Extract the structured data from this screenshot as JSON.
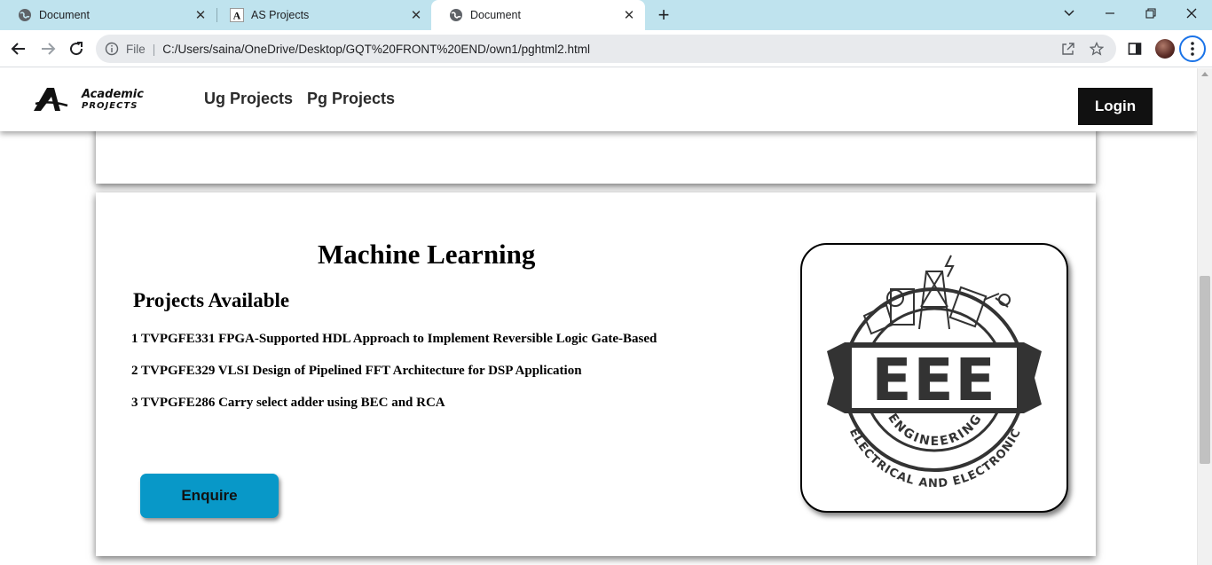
{
  "browser": {
    "tabs": [
      {
        "title": "Document",
        "icon": "globe-icon",
        "active": false
      },
      {
        "title": "AS Projects",
        "icon": "site-a-icon",
        "active": false
      },
      {
        "title": "Document",
        "icon": "globe-icon",
        "active": true
      }
    ],
    "address": {
      "scheme_label": "File",
      "url": "C:/Users/saina/OneDrive/Desktop/GQT%20FRONT%20END/own1/pghtml2.html"
    }
  },
  "header": {
    "logo_text_top": "Academic",
    "logo_text_bottom": "PROJECTS",
    "nav": [
      "Ug Projects",
      "Pg Projects"
    ],
    "login_label": "Login"
  },
  "section": {
    "title": "Machine Learning",
    "subtitle": "Projects Available",
    "projects": [
      "1 TVPGFE331 FPGA-Supported HDL Approach to Implement Reversible Logic Gate-Based",
      "2 TVPGFE329 VLSI Design of Pipelined FFT Architecture for DSP Application",
      "3 TVPGFE286 Carry select adder using BEC and RCA"
    ],
    "button_label": "Enquire",
    "emblem": {
      "big_text": "EEE",
      "ring_text_inner": "ENGINEERING",
      "ring_text_outer": "ELECTRICAL AND ELECTRONIC"
    }
  },
  "colors": {
    "tabbar_bg": "#bfe3ee",
    "enquire_bg": "#0898c8",
    "login_bg": "#111111",
    "emblem_dark": "#333333"
  }
}
